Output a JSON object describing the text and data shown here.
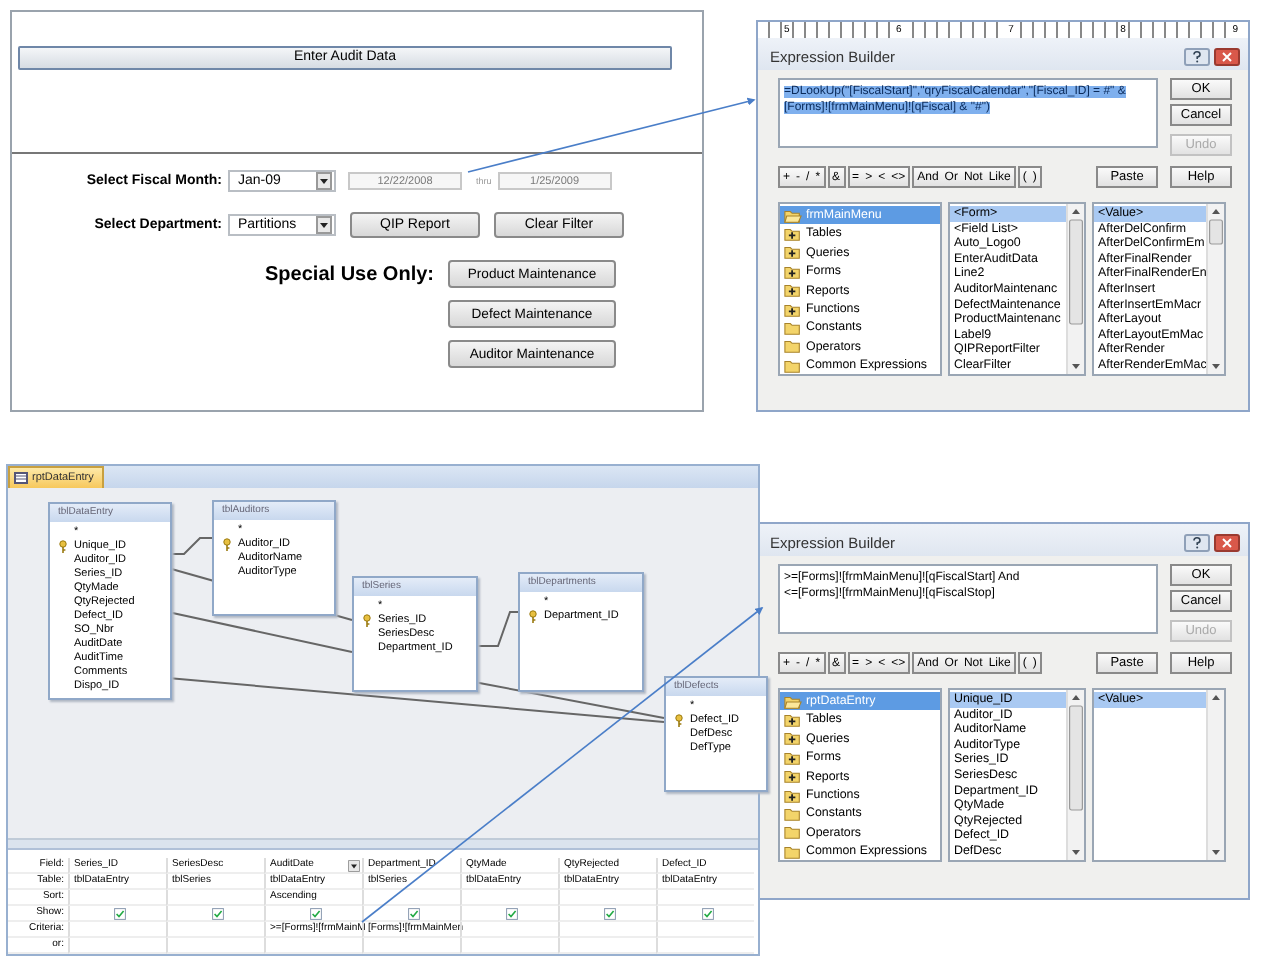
{
  "form": {
    "header_button": "Enter Audit Data",
    "fiscal_month": {
      "label": "Select Fiscal Month:",
      "value": "Jan-09",
      "start": {
        "value": "12/22/2008",
        "disabled": true
      },
      "thru": "thru",
      "end": {
        "value": "1/25/2009",
        "disabled": true
      }
    },
    "department": {
      "label": "Select Department:",
      "value": "Partitions"
    },
    "buttons": [
      "QIP Report",
      "Clear Filter"
    ],
    "special_label": "Special Use Only:",
    "special_buttons": [
      "Product Maintenance",
      "Defect Maintenance",
      "Auditor Maintenance"
    ]
  },
  "expression_builders": [
    {
      "ruler_marks": [
        "5",
        "6",
        "7",
        "8",
        "9"
      ],
      "title": "Expression Builder",
      "expression_selected": true,
      "expression_lines": [
        "=DLookUp(\"[FiscalStart]\",\"qryFiscalCalendar\",\"[Fiscal_ID] = #\" &",
        "[Forms]![frmMainMenu]![qFiscal] & \"#\")"
      ],
      "side_buttons": [
        {
          "label": "OK",
          "disabled": false
        },
        {
          "label": "Cancel",
          "disabled": false
        },
        {
          "label": "Undo",
          "disabled": true
        }
      ],
      "operator_groups": [
        [
          "+",
          "-",
          "/",
          "*"
        ],
        [
          "&"
        ],
        [
          "=",
          ">",
          "<",
          "<>"
        ],
        [
          "And",
          "Or",
          "Not",
          "Like"
        ],
        [
          "(",
          ")"
        ]
      ],
      "paste": "Paste",
      "help": "Help",
      "lists": [
        [
          {
            "label": "frmMainMenu",
            "kind": "open",
            "selected": true
          },
          {
            "label": "Tables",
            "kind": "expandable",
            "selected": false
          },
          {
            "label": "Queries",
            "kind": "expandable",
            "selected": false
          },
          {
            "label": "Forms",
            "kind": "expandable",
            "selected": false
          },
          {
            "label": "Reports",
            "kind": "expandable",
            "selected": false
          },
          {
            "label": "Functions",
            "kind": "expandable",
            "selected": false
          },
          {
            "label": "Constants",
            "kind": "folder",
            "selected": false
          },
          {
            "label": "Operators",
            "kind": "folder",
            "selected": false
          },
          {
            "label": "Common Expressions",
            "kind": "folder",
            "selected": false
          }
        ],
        [
          {
            "label": "<Form>",
            "selected": true
          },
          {
            "label": "<Field List>",
            "selected": false
          },
          {
            "label": "Auto_Logo0",
            "selected": false
          },
          {
            "label": "EnterAuditData",
            "selected": false
          },
          {
            "label": "Line2",
            "selected": false
          },
          {
            "label": "AuditorMaintenanc",
            "selected": false
          },
          {
            "label": "DefectMaintenance",
            "selected": false
          },
          {
            "label": "ProductMaintenanc",
            "selected": false
          },
          {
            "label": "Label9",
            "selected": false
          },
          {
            "label": "QIPReportFilter",
            "selected": false
          },
          {
            "label": "ClearFilter",
            "selected": false
          }
        ],
        [
          {
            "label": "<Value>",
            "selected": true
          },
          {
            "label": "AfterDelConfirm",
            "selected": false
          },
          {
            "label": "AfterDelConfirmEm",
            "selected": false
          },
          {
            "label": "AfterFinalRender",
            "selected": false
          },
          {
            "label": "AfterFinalRenderEn",
            "selected": false
          },
          {
            "label": "AfterInsert",
            "selected": false
          },
          {
            "label": "AfterInsertEmMacr",
            "selected": false
          },
          {
            "label": "AfterLayout",
            "selected": false
          },
          {
            "label": "AfterLayoutEmMac",
            "selected": false
          },
          {
            "label": "AfterRender",
            "selected": false
          },
          {
            "label": "AfterRenderEmMac",
            "selected": false
          }
        ]
      ]
    },
    {
      "title": "Expression Builder",
      "expression_selected": false,
      "expression_lines": [
        ">=[Forms]![frmMainMenu]![qFiscalStart] And",
        "<=[Forms]![frmMainMenu]![qFiscalStop]"
      ],
      "side_buttons": [
        {
          "label": "OK",
          "disabled": false
        },
        {
          "label": "Cancel",
          "disabled": false
        },
        {
          "label": "Undo",
          "disabled": true
        }
      ],
      "operator_groups": [
        [
          "+",
          "-",
          "/",
          "*"
        ],
        [
          "&"
        ],
        [
          "=",
          ">",
          "<",
          "<>"
        ],
        [
          "And",
          "Or",
          "Not",
          "Like"
        ],
        [
          "(",
          ")"
        ]
      ],
      "paste": "Paste",
      "help": "Help",
      "lists": [
        [
          {
            "label": "rptDataEntry",
            "kind": "open",
            "selected": true
          },
          {
            "label": "Tables",
            "kind": "expandable",
            "selected": false
          },
          {
            "label": "Queries",
            "kind": "expandable",
            "selected": false
          },
          {
            "label": "Forms",
            "kind": "expandable",
            "selected": false
          },
          {
            "label": "Reports",
            "kind": "expandable",
            "selected": false
          },
          {
            "label": "Functions",
            "kind": "expandable",
            "selected": false
          },
          {
            "label": "Constants",
            "kind": "folder",
            "selected": false
          },
          {
            "label": "Operators",
            "kind": "folder",
            "selected": false
          },
          {
            "label": "Common Expressions",
            "kind": "folder",
            "selected": false
          }
        ],
        [
          {
            "label": "Unique_ID",
            "selected": true
          },
          {
            "label": "Auditor_ID",
            "selected": false
          },
          {
            "label": "AuditorName",
            "selected": false
          },
          {
            "label": "AuditorType",
            "selected": false
          },
          {
            "label": "Series_ID",
            "selected": false
          },
          {
            "label": "SeriesDesc",
            "selected": false
          },
          {
            "label": "Department_ID",
            "selected": false
          },
          {
            "label": "QtyMade",
            "selected": false
          },
          {
            "label": "QtyRejected",
            "selected": false
          },
          {
            "label": "Defect_ID",
            "selected": false
          },
          {
            "label": "DefDesc",
            "selected": false
          }
        ],
        [
          {
            "label": "<Value>",
            "selected": true
          }
        ]
      ]
    }
  ],
  "query": {
    "tab": "rptDataEntry",
    "tables": [
      {
        "name": "tblDataEntry",
        "fields": [
          {
            "name": "*",
            "key": false
          },
          {
            "name": "Unique_ID",
            "key": true
          },
          {
            "name": "Auditor_ID",
            "key": false
          },
          {
            "name": "Series_ID",
            "key": false
          },
          {
            "name": "QtyMade",
            "key": false
          },
          {
            "name": "QtyRejected",
            "key": false
          },
          {
            "name": "Defect_ID",
            "key": false
          },
          {
            "name": "SO_Nbr",
            "key": false
          },
          {
            "name": "AuditDate",
            "key": false
          },
          {
            "name": "AuditTime",
            "key": false
          },
          {
            "name": "Comments",
            "key": false
          },
          {
            "name": "Dispo_ID",
            "key": false
          }
        ]
      },
      {
        "name": "tblAuditors",
        "fields": [
          {
            "name": "*",
            "key": false
          },
          {
            "name": "Auditor_ID",
            "key": true
          },
          {
            "name": "AuditorName",
            "key": false
          },
          {
            "name": "AuditorType",
            "key": false
          }
        ]
      },
      {
        "name": "tblSeries",
        "fields": [
          {
            "name": "*",
            "key": false
          },
          {
            "name": "Series_ID",
            "key": true
          },
          {
            "name": "SeriesDesc",
            "key": false
          },
          {
            "name": "Department_ID",
            "key": false
          }
        ]
      },
      {
        "name": "tblDepartments",
        "fields": [
          {
            "name": "*",
            "key": false
          },
          {
            "name": "Department_ID",
            "key": true
          }
        ]
      },
      {
        "name": "tblDefects",
        "fields": [
          {
            "name": "*",
            "key": false
          },
          {
            "name": "Defect_ID",
            "key": true
          },
          {
            "name": "DefDesc",
            "key": false
          },
          {
            "name": "DefType",
            "key": false
          }
        ]
      }
    ],
    "grid": {
      "row_labels": [
        "Field:",
        "Table:",
        "Sort:",
        "Show:",
        "Criteria:",
        "or:"
      ],
      "columns": [
        {
          "field": "Series_ID",
          "table": "tblDataEntry",
          "show": true
        },
        {
          "field": "SeriesDesc",
          "table": "tblSeries",
          "show": true
        },
        {
          "field": "AuditDate",
          "table": "tblDataEntry",
          "sort": "Ascending",
          "show": true,
          "criteria": ">=[Forms]![frmMainM",
          "dropdown": true
        },
        {
          "field": "Department_ID",
          "table": "tblSeries",
          "show": true,
          "criteria": "[Forms]![frmMainMen"
        },
        {
          "field": "QtyMade",
          "table": "tblDataEntry",
          "show": true
        },
        {
          "field": "QtyRejected",
          "table": "tblDataEntry",
          "show": true
        },
        {
          "field": "Defect_ID",
          "table": "tblDataEntry",
          "show": true
        }
      ]
    }
  }
}
